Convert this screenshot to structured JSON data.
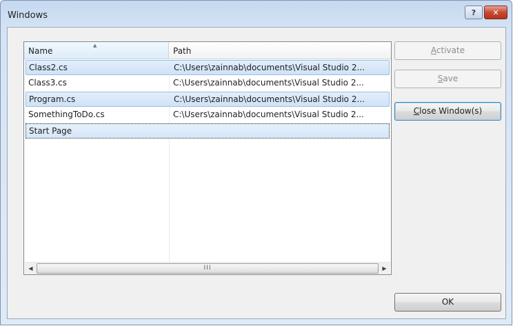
{
  "window": {
    "title": "Windows"
  },
  "titlebar": {
    "help_glyph": "?",
    "close_glyph": "✕"
  },
  "list": {
    "columns": [
      "Name",
      "Path"
    ],
    "sort_indicator": "▲",
    "rows": [
      {
        "name": "Class2.cs",
        "path": "C:\\Users\\zainnab\\documents\\Visual Studio 2...",
        "selected": true
      },
      {
        "name": "Class3.cs",
        "path": "C:\\Users\\zainnab\\documents\\Visual Studio 2...",
        "selected": false
      },
      {
        "name": "Program.cs",
        "path": "C:\\Users\\zainnab\\documents\\Visual Studio 2...",
        "selected": true
      },
      {
        "name": "SomethingToDo.cs",
        "path": "C:\\Users\\zainnab\\documents\\Visual Studio 2...",
        "selected": false
      },
      {
        "name": "Start Page",
        "path": "",
        "selected": true,
        "focused": true
      }
    ],
    "scrollbar": {
      "left_arrow": "◀",
      "right_arrow": "▶",
      "grip": "III"
    }
  },
  "buttons": {
    "activate": {
      "label": "Activate",
      "access_key": "A",
      "rest": "ctivate",
      "enabled": false
    },
    "save": {
      "label": "Save",
      "access_key": "S",
      "rest": "ave",
      "enabled": false
    },
    "close_windows": {
      "label": "Close Window(s)",
      "access_key": "C",
      "rest": "lose Window(s)",
      "enabled": true
    },
    "ok": {
      "label": "OK",
      "enabled": true
    }
  },
  "colors": {
    "title_bar": "#c5d8ef",
    "selection": "#cfe2f7",
    "close_button": "#c74a32"
  }
}
